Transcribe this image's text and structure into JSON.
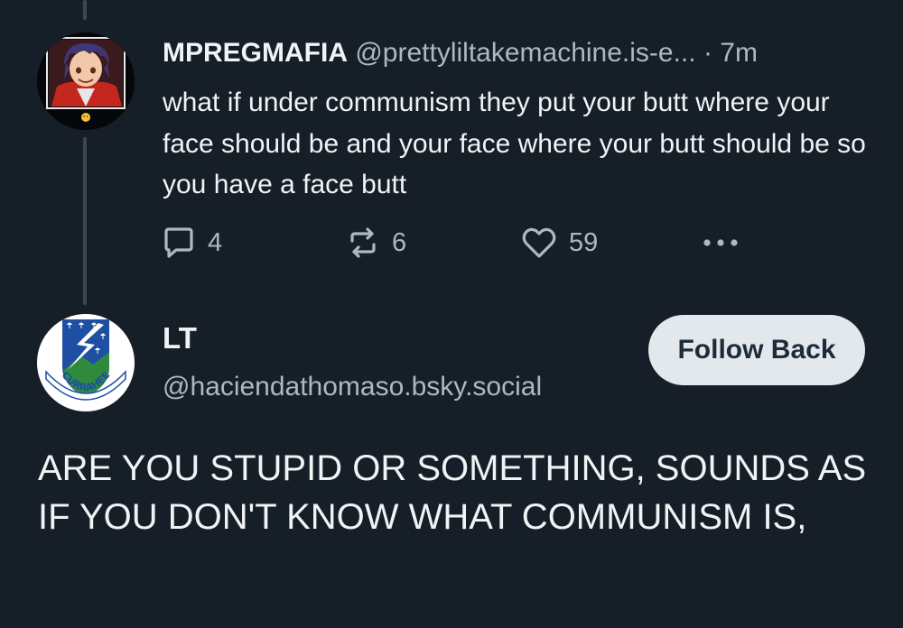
{
  "parent_post": {
    "display_name": "MPREGMAFIA",
    "handle": "@prettyliltakemachine.is-e...",
    "separator": "·",
    "timestamp": "7m",
    "text": "what if under communism they put your butt where your face should be and your face where your butt should be so you have a face butt",
    "actions": {
      "reply_icon": "comment-bubble-icon",
      "reply_count": "4",
      "repost_icon": "repost-arrows-icon",
      "repost_count": "6",
      "like_icon": "heart-icon",
      "like_count": "59",
      "more_icon": "ellipsis-icon"
    }
  },
  "reply_post": {
    "display_name": "LT",
    "handle": "@haciendathomaso.bsky.social",
    "follow_button_label": "Follow Back",
    "avatar_text": "CURRAHEE",
    "text": "ARE YOU STUPID OR SOMETHING, SOUNDS AS IF YOU DON'T KNOW WHAT COMMUNISM IS,"
  },
  "colors": {
    "background": "#161e27",
    "primary_text": "#f1f3f5",
    "secondary_text": "#aeb8c4",
    "thread_line": "#3a4756",
    "follow_button_bg": "#e3e8ed",
    "follow_button_text": "#1e2c3a"
  }
}
